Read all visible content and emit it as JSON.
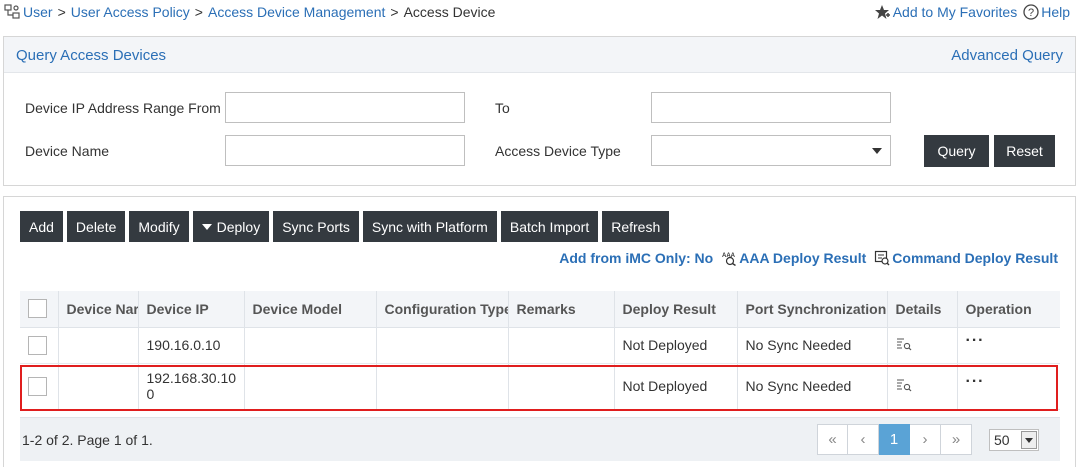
{
  "breadcrumb": {
    "items": [
      "User",
      "User Access Policy",
      "Access Device Management"
    ],
    "current": "Access Device",
    "separator": ">"
  },
  "top_links": {
    "favorites": "Add to My Favorites",
    "help": "Help"
  },
  "query": {
    "title": "Query Access Devices",
    "advanced": "Advanced Query",
    "ip_from_label": "Device IP Address Range From",
    "ip_from_value": "",
    "to_label": "To",
    "to_value": "",
    "name_label": "Device Name",
    "name_value": "",
    "type_label": "Access Device Type",
    "type_value": "",
    "query_button": "Query",
    "reset_button": "Reset"
  },
  "toolbar": {
    "add": "Add",
    "delete": "Delete",
    "modify": "Modify",
    "deploy": "Deploy",
    "sync_ports": "Sync Ports",
    "sync_platform": "Sync with Platform",
    "batch_import": "Batch Import",
    "refresh": "Refresh"
  },
  "actions": {
    "add_from_imc": "Add from iMC Only: No",
    "aaa_result": "AAA Deploy Result",
    "command_result": "Command Deploy Result"
  },
  "table": {
    "columns": [
      "Device Nar",
      "Device IP",
      "Device Model",
      "Configuration Type",
      "Remarks",
      "Deploy Result",
      "Port Synchronization",
      "Details",
      "Operation"
    ],
    "rows": [
      {
        "name": "",
        "ip": "190.16.0.10",
        "model": "",
        "config": "",
        "remarks": "",
        "deploy": "Not Deployed",
        "port_sync": "No Sync Needed",
        "operation": "···"
      },
      {
        "name": "",
        "ip": "192.168.30.100",
        "model": "",
        "config": "",
        "remarks": "",
        "deploy": "Not Deployed",
        "port_sync": "No Sync Needed",
        "operation": "···"
      }
    ]
  },
  "pagination": {
    "info": "1-2 of 2. Page 1 of 1.",
    "first": "«",
    "prev": "‹",
    "current": "1",
    "next": "›",
    "last": "»",
    "page_size": "50"
  },
  "colors": {
    "accent": "#2b6fb6",
    "button_dark": "#343a40",
    "highlight": "#e01e1e",
    "active_page": "#5aa3d6"
  }
}
